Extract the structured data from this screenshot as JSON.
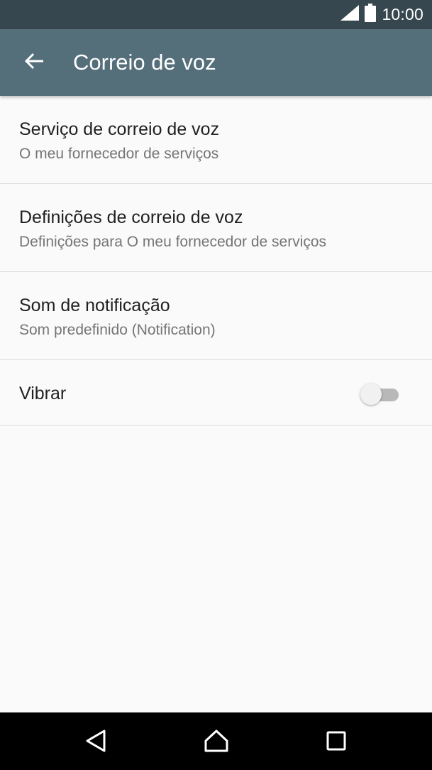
{
  "status_bar": {
    "time": "10:00",
    "icons": [
      "signal-icon",
      "battery-icon"
    ]
  },
  "app_bar": {
    "back_icon": "arrow-left-icon",
    "title": "Correio de voz"
  },
  "settings": {
    "items": [
      {
        "title": "Serviço de correio de voz",
        "subtitle": "O meu fornecedor de serviços"
      },
      {
        "title": "Definições de correio de voz",
        "subtitle": "Definições para O meu fornecedor de serviços"
      },
      {
        "title": "Som de notificação",
        "subtitle": "Som predefinido (Notification)"
      },
      {
        "title": "Vibrar",
        "toggle_on": false
      }
    ]
  },
  "nav_bar": {
    "icons": [
      "back-triangle-icon",
      "home-icon",
      "recents-icon"
    ]
  },
  "colors": {
    "status_bar": "#37474f",
    "app_bar": "#546e7a",
    "background": "#fafafa"
  }
}
